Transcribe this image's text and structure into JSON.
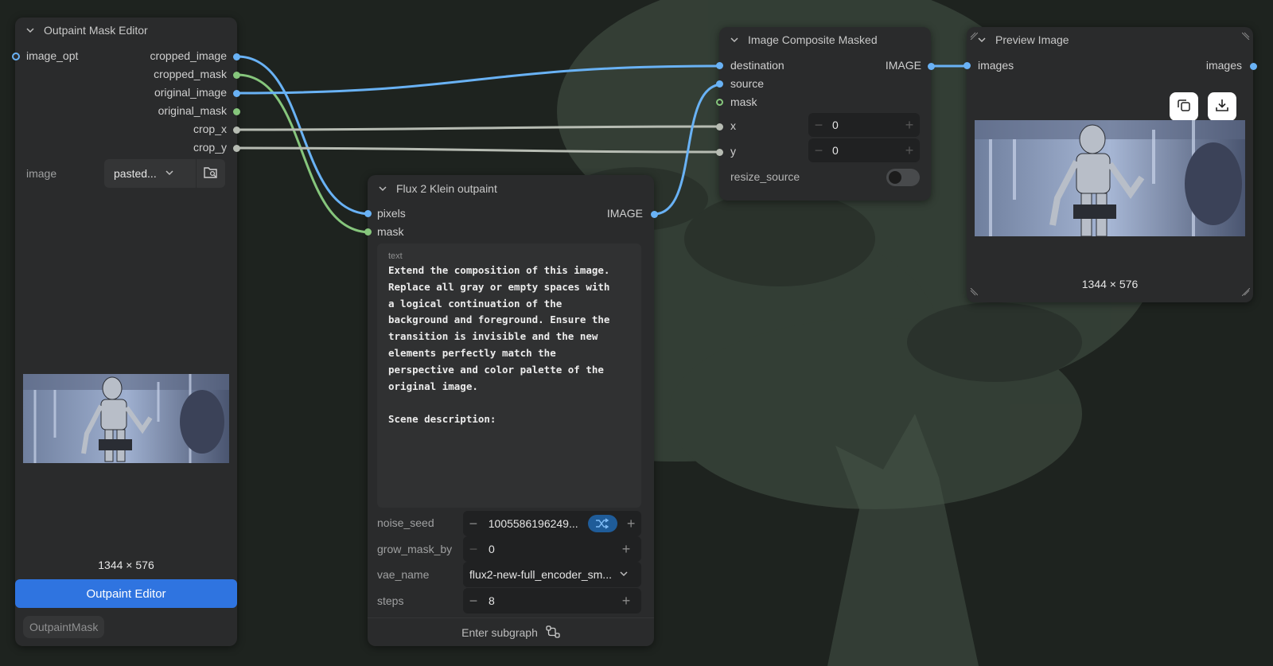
{
  "nodes": {
    "outpaint_mask_editor": {
      "title": "Outpaint Mask Editor",
      "input_label": "image_opt",
      "outputs": [
        "cropped_image",
        "cropped_mask",
        "original_image",
        "original_mask",
        "crop_x",
        "crop_y"
      ],
      "image_label": "image",
      "image_value": "pasted...",
      "dimensions": "1344 × 576",
      "button_label": "Outpaint Editor",
      "badge": "OutpaintMask"
    },
    "flux_klein": {
      "title": "Flux 2 Klein outpaint",
      "inputs": [
        "pixels",
        "mask"
      ],
      "output": "IMAGE",
      "text_label": "text",
      "text_value": "Extend the composition of this image.\nReplace all gray or empty spaces with\na logical continuation of the\nbackground and foreground. Ensure the\ntransition is invisible and the new\nelements perfectly match the\nperspective and color palette of the\noriginal image.\n\nScene description:",
      "noise_seed_label": "noise_seed",
      "noise_seed_value": "1005586196249...",
      "grow_label": "grow_mask_by",
      "grow_value": "0",
      "vae_label": "vae_name",
      "vae_value": "flux2-new-full_encoder_sm...",
      "steps_label": "steps",
      "steps_value": "8",
      "footer": "Enter subgraph"
    },
    "composite": {
      "title": "Image Composite Masked",
      "inputs": [
        "destination",
        "source",
        "mask"
      ],
      "output": "IMAGE",
      "x_label": "x",
      "x_value": "0",
      "y_label": "y",
      "y_value": "0",
      "resize_label": "resize_source",
      "resize_on": false
    },
    "preview": {
      "title": "Preview Image",
      "input": "images",
      "output": "images",
      "dimensions": "1344 × 576"
    }
  },
  "icons": [
    "chevron-down-icon",
    "folder-search-icon",
    "shuffle-icon",
    "minus-icon",
    "plus-icon",
    "copy-icon",
    "download-icon",
    "subgraph-icon",
    "resize-handle-icon"
  ],
  "colors": {
    "image_wire": "#69b2f5",
    "mask_wire": "#86c67c",
    "int_wire": "#b7bcb3",
    "button": "#2f74e0",
    "node_bg": "#2a2b2c"
  }
}
